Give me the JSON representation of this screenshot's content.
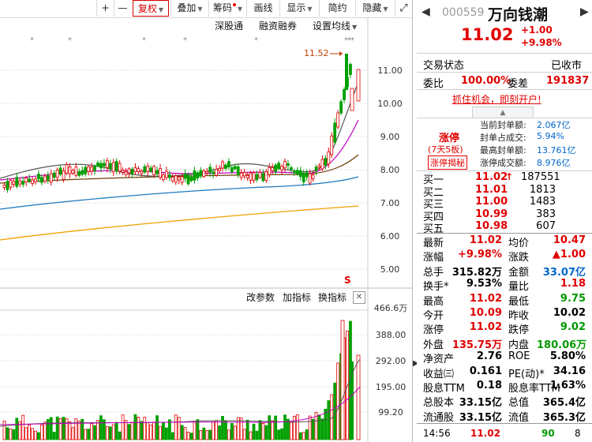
{
  "toolbar": {
    "buttons": [
      "+",
      "—",
      "复权",
      "叠加",
      "筹码",
      "画线",
      "显示",
      "简约",
      "隐藏"
    ]
  },
  "submenu": {
    "a": "深股通",
    "b": "融资融券",
    "c": "设置均线"
  },
  "chart": {
    "price_ticks": [
      "11.00",
      "10.00",
      "9.00",
      "8.00",
      "7.00",
      "6.00",
      "5.00"
    ],
    "high_marker": "11.52",
    "vol_ticks": [
      "466.6万",
      "388.00",
      "292.00",
      "195.00",
      "99.20"
    ],
    "vol_menu": {
      "a": "改参数",
      "b": "加指标",
      "c": "换指标",
      "close": "✕"
    },
    "colors": {
      "up": "#e00000",
      "down": "#00a000",
      "ma5": "#555555",
      "ma10": "#c000c0",
      "ma20": "#6b3d00",
      "ma60": "#1e7ac0",
      "ma120": "#f0a000"
    }
  },
  "stock": {
    "code": "000559",
    "name": "万向钱潮",
    "price": "11.02",
    "change": "+1.00",
    "change_pct": "+9.98%"
  },
  "status": {
    "label": "交易状态",
    "value": "已收市",
    "ratio_label": "委比",
    "ratio_value": "100.00%",
    "diff_label": "委差",
    "diff_value": "191837"
  },
  "promo": "抓住机会，即刻开户!",
  "limit": {
    "title": "涨停",
    "days": "(7天5板)",
    "reveal": "涨停揭秘",
    "rows": [
      {
        "label": "当前封单额:",
        "value": "2.067亿"
      },
      {
        "label": "封单占成交:",
        "value": "5.94%"
      },
      {
        "label": "最高封单额:",
        "value": "13.761亿"
      },
      {
        "label": "涨停成交额:",
        "value": "8.976亿"
      }
    ]
  },
  "bids": [
    {
      "label": "买一",
      "price": "11.02",
      "arrow": "↑",
      "vol": "187551"
    },
    {
      "label": "买二",
      "price": "11.01",
      "arrow": "",
      "vol": "1813"
    },
    {
      "label": "买三",
      "price": "11.00",
      "arrow": "",
      "vol": "1483"
    },
    {
      "label": "买四",
      "price": "10.99",
      "arrow": "",
      "vol": "383"
    },
    {
      "label": "买五",
      "price": "10.98",
      "arrow": "",
      "vol": "607"
    }
  ],
  "quote": [
    {
      "l1": "最新",
      "v1": "11.02",
      "c1": "red",
      "l2": "均价",
      "v2": "10.47",
      "c2": "red"
    },
    {
      "l1": "涨幅",
      "v1": "+9.98%",
      "c1": "red",
      "l2": "涨跌",
      "v2": "▲1.00",
      "c2": "red"
    },
    {
      "l1": "总手",
      "v1": "315.82万",
      "c1": "",
      "l2": "金额",
      "v2": "33.07亿",
      "c2": "blue"
    },
    {
      "l1": "换手*",
      "v1": "9.53%",
      "c1": "",
      "l2": "量比",
      "v2": "1.18",
      "c2": "red"
    },
    {
      "l1": "最高",
      "v1": "11.02",
      "c1": "red",
      "l2": "最低",
      "v2": "9.75",
      "c2": "green"
    },
    {
      "l1": "今开",
      "v1": "10.09",
      "c1": "red",
      "l2": "昨收",
      "v2": "10.02",
      "c2": ""
    },
    {
      "l1": "涨停",
      "v1": "11.02",
      "c1": "red",
      "l2": "跌停",
      "v2": "9.02",
      "c2": "green"
    },
    {
      "l1": "外盘",
      "v1": "135.75万",
      "c1": "red",
      "l2": "内盘",
      "v2": "180.06万",
      "c2": "green"
    },
    {
      "l1": "净资产",
      "v1": "2.76",
      "c1": "",
      "l2": "ROE",
      "v2": "5.80%",
      "c2": ""
    },
    {
      "l1": "收益㈢",
      "v1": "0.161",
      "c1": "",
      "l2": "PE(动)*",
      "v2": "34.16",
      "c2": ""
    },
    {
      "l1": "股息TTM",
      "v1": "0.18",
      "c1": "",
      "l2": "股息率TTM",
      "v2": "1.63%",
      "c2": ""
    },
    {
      "l1": "总股本",
      "v1": "33.15亿",
      "c1": "",
      "l2": "总值",
      "v2": "365.4亿",
      "c2": ""
    },
    {
      "l1": "流通股",
      "v1": "33.15亿",
      "c1": "",
      "l2": "流值",
      "v2": "365.3亿",
      "c2": ""
    }
  ],
  "tick": {
    "time": "14:56",
    "price": "11.02",
    "vol": "90",
    "num": "8"
  }
}
